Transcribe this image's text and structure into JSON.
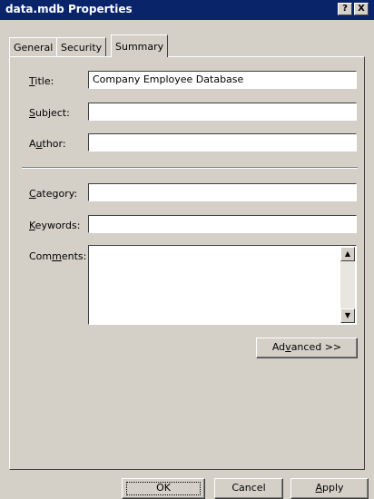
{
  "window": {
    "title": "data.mdb Properties",
    "help_glyph": "?",
    "close_glyph": "X"
  },
  "tabs": [
    {
      "label": "General",
      "active": false
    },
    {
      "label": "Security",
      "active": false
    },
    {
      "label": "Summary",
      "active": true
    }
  ],
  "fields": {
    "title": {
      "pre": "",
      "key": "T",
      "post": "itle:",
      "value": "Company Employee Database"
    },
    "subject": {
      "pre": "",
      "key": "S",
      "post": "ubject:",
      "value": ""
    },
    "author": {
      "pre": "A",
      "key": "u",
      "post": "thor:",
      "value": ""
    },
    "category": {
      "pre": "",
      "key": "C",
      "post": "ategory:",
      "value": ""
    },
    "keywords": {
      "pre": "",
      "key": "K",
      "post": "eywords:",
      "value": ""
    },
    "comments": {
      "pre": "Com",
      "key": "m",
      "post": "ents:",
      "value": ""
    }
  },
  "buttons": {
    "advanced": {
      "pre": "Ad",
      "key": "v",
      "post": "anced >>"
    },
    "ok": "OK",
    "cancel": "Cancel",
    "apply": {
      "pre": "",
      "key": "A",
      "post": "pply"
    }
  },
  "icons": {
    "scroll_up": "▲",
    "scroll_down": "▼"
  }
}
